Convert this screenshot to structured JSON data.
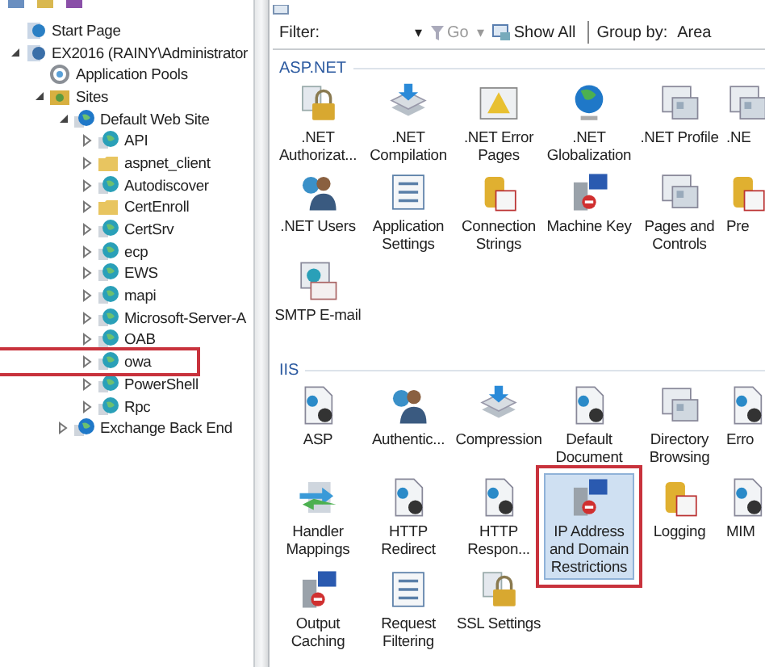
{
  "tree": [
    {
      "label": "Start Page",
      "kind": "page"
    },
    {
      "label": "EX2016 (RAINY\\Administrator",
      "kind": "server",
      "expanded": true,
      "children": [
        {
          "label": "Application Pools",
          "kind": "pool"
        },
        {
          "label": "Sites",
          "kind": "sites",
          "expanded": true,
          "children": [
            {
              "label": "Default Web Site",
              "kind": "globe",
              "expanded": true,
              "children": [
                {
                  "label": "API",
                  "kind": "app",
                  "expanded": false,
                  "highlighted": false
                },
                {
                  "label": "aspnet_client",
                  "kind": "folder",
                  "expanded": false,
                  "highlighted": false
                },
                {
                  "label": "Autodiscover",
                  "kind": "app",
                  "expanded": false,
                  "highlighted": false
                },
                {
                  "label": "CertEnroll",
                  "kind": "folder",
                  "expanded": false,
                  "highlighted": false
                },
                {
                  "label": "CertSrv",
                  "kind": "app",
                  "expanded": false,
                  "highlighted": false
                },
                {
                  "label": "ecp",
                  "kind": "app",
                  "expanded": false,
                  "highlighted": false
                },
                {
                  "label": "EWS",
                  "kind": "app",
                  "expanded": false,
                  "highlighted": false
                },
                {
                  "label": "mapi",
                  "kind": "app",
                  "expanded": false,
                  "highlighted": false
                },
                {
                  "label": "Microsoft-Server-A",
                  "kind": "app",
                  "expanded": false,
                  "highlighted": false
                },
                {
                  "label": "OAB",
                  "kind": "app",
                  "expanded": false,
                  "highlighted": false
                },
                {
                  "label": "owa",
                  "kind": "app",
                  "expanded": false,
                  "highlighted": true
                },
                {
                  "label": "PowerShell",
                  "kind": "app",
                  "expanded": false,
                  "highlighted": false
                },
                {
                  "label": "Rpc",
                  "kind": "app",
                  "expanded": false,
                  "highlighted": false
                }
              ]
            },
            {
              "label": "Exchange Back End",
              "kind": "globe",
              "expanded": false
            }
          ]
        }
      ]
    }
  ],
  "filter_bar": {
    "filter_label": "Filter:",
    "dropdown": "▾",
    "go": "Go",
    "go_dropdown": "▾",
    "show_all": "Show All",
    "group_by_label": "Group by:",
    "group_by_value": "Area"
  },
  "groups": [
    {
      "title": "ASP.NET",
      "features": [
        {
          "label": ".NET Authorizat...",
          "kind": "lock",
          "selected": false,
          "highlighted": false
        },
        {
          "label": ".NET Compilation",
          "kind": "stack",
          "selected": false,
          "highlighted": false
        },
        {
          "label": ".NET Error Pages",
          "kind": "warning",
          "selected": false,
          "highlighted": false
        },
        {
          "label": ".NET Globalization",
          "kind": "globe",
          "selected": false,
          "highlighted": false
        },
        {
          "label": ".NET Profile",
          "kind": "window",
          "selected": false,
          "highlighted": false
        },
        {
          "label": ".NE",
          "kind": "window",
          "selected": false,
          "highlighted": false
        },
        {
          "label": ".NET Users",
          "kind": "users",
          "selected": false,
          "highlighted": false
        },
        {
          "label": "Application Settings",
          "kind": "list",
          "selected": false,
          "highlighted": false
        },
        {
          "label": "Connection Strings",
          "kind": "db",
          "selected": false,
          "highlighted": false
        },
        {
          "label": "Machine Key",
          "kind": "server",
          "selected": false,
          "highlighted": false
        },
        {
          "label": "Pages and Controls",
          "kind": "window",
          "selected": false,
          "highlighted": false
        },
        {
          "label": "Pre",
          "kind": "db",
          "selected": false,
          "highlighted": false
        },
        {
          "label": "SMTP E-mail",
          "kind": "mail",
          "selected": false,
          "highlighted": false
        }
      ]
    },
    {
      "title": "IIS",
      "features": [
        {
          "label": "ASP",
          "kind": "doc",
          "selected": false,
          "highlighted": false
        },
        {
          "label": "Authentic...",
          "kind": "users",
          "selected": false,
          "highlighted": false
        },
        {
          "label": "Compression",
          "kind": "stack",
          "selected": false,
          "highlighted": false
        },
        {
          "label": "Default Document",
          "kind": "doc",
          "selected": false,
          "highlighted": false
        },
        {
          "label": "Directory Browsing",
          "kind": "window",
          "selected": false,
          "highlighted": false
        },
        {
          "label": "Erro",
          "kind": "doc",
          "selected": false,
          "highlighted": false
        },
        {
          "label": "Handler Mappings",
          "kind": "arrows",
          "selected": false,
          "highlighted": false
        },
        {
          "label": "HTTP Redirect",
          "kind": "doc",
          "selected": false,
          "highlighted": false
        },
        {
          "label": "HTTP Respon...",
          "kind": "doc",
          "selected": false,
          "highlighted": false
        },
        {
          "label": "IP Address and Domain Restrictions",
          "kind": "server",
          "selected": true,
          "highlighted": true
        },
        {
          "label": "Logging",
          "kind": "db",
          "selected": false,
          "highlighted": false
        },
        {
          "label": "MIM",
          "kind": "doc",
          "selected": false,
          "highlighted": false
        },
        {
          "label": "Output Caching",
          "kind": "server",
          "selected": false,
          "highlighted": false
        },
        {
          "label": "Request Filtering",
          "kind": "list",
          "selected": false,
          "highlighted": false
        },
        {
          "label": "SSL Settings",
          "kind": "lock",
          "selected": false,
          "highlighted": false
        }
      ]
    }
  ]
}
